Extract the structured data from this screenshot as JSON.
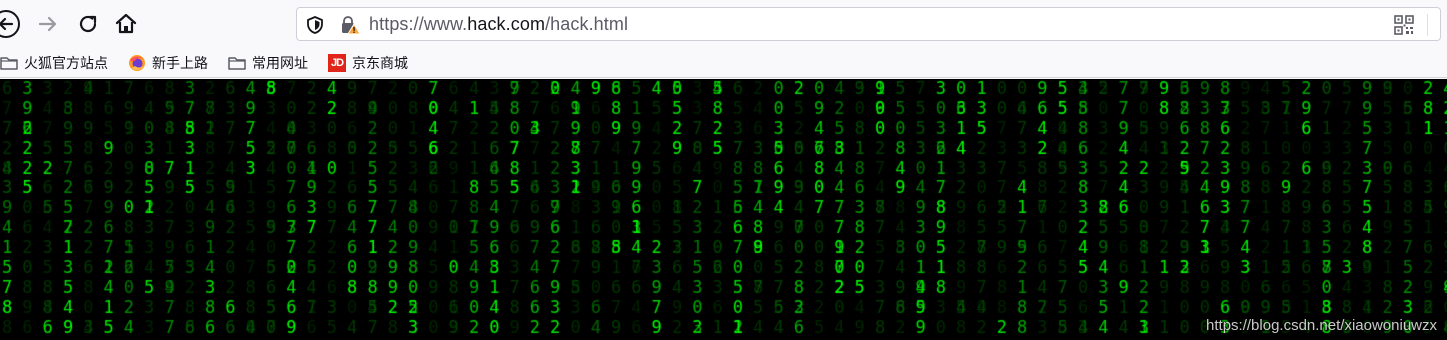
{
  "toolbar": {
    "url_prefix": "https://www.",
    "url_host": "hack.com",
    "url_path": "/hack.html"
  },
  "icons": {
    "back": "back-arrow-icon",
    "forward": "forward-arrow-icon",
    "reload": "reload-icon",
    "home": "home-icon",
    "tracking": "shield-icon",
    "security": "insecure-lock-icon",
    "qr": "qr-code-icon"
  },
  "bookmarks": [
    {
      "label": "火狐官方站点",
      "icon": "folder-icon"
    },
    {
      "label": "新手上路",
      "icon": "firefox-icon"
    },
    {
      "label": "常用网址",
      "icon": "folder-icon"
    },
    {
      "label": "京东商城",
      "icon": "jd-logo",
      "badge": "JD"
    }
  ],
  "page": {
    "watermark": "https://blog.csdn.net/xiaowoniuwzx"
  },
  "colors": {
    "matrix_bright": "#00ff00",
    "matrix_background": "#000000"
  }
}
